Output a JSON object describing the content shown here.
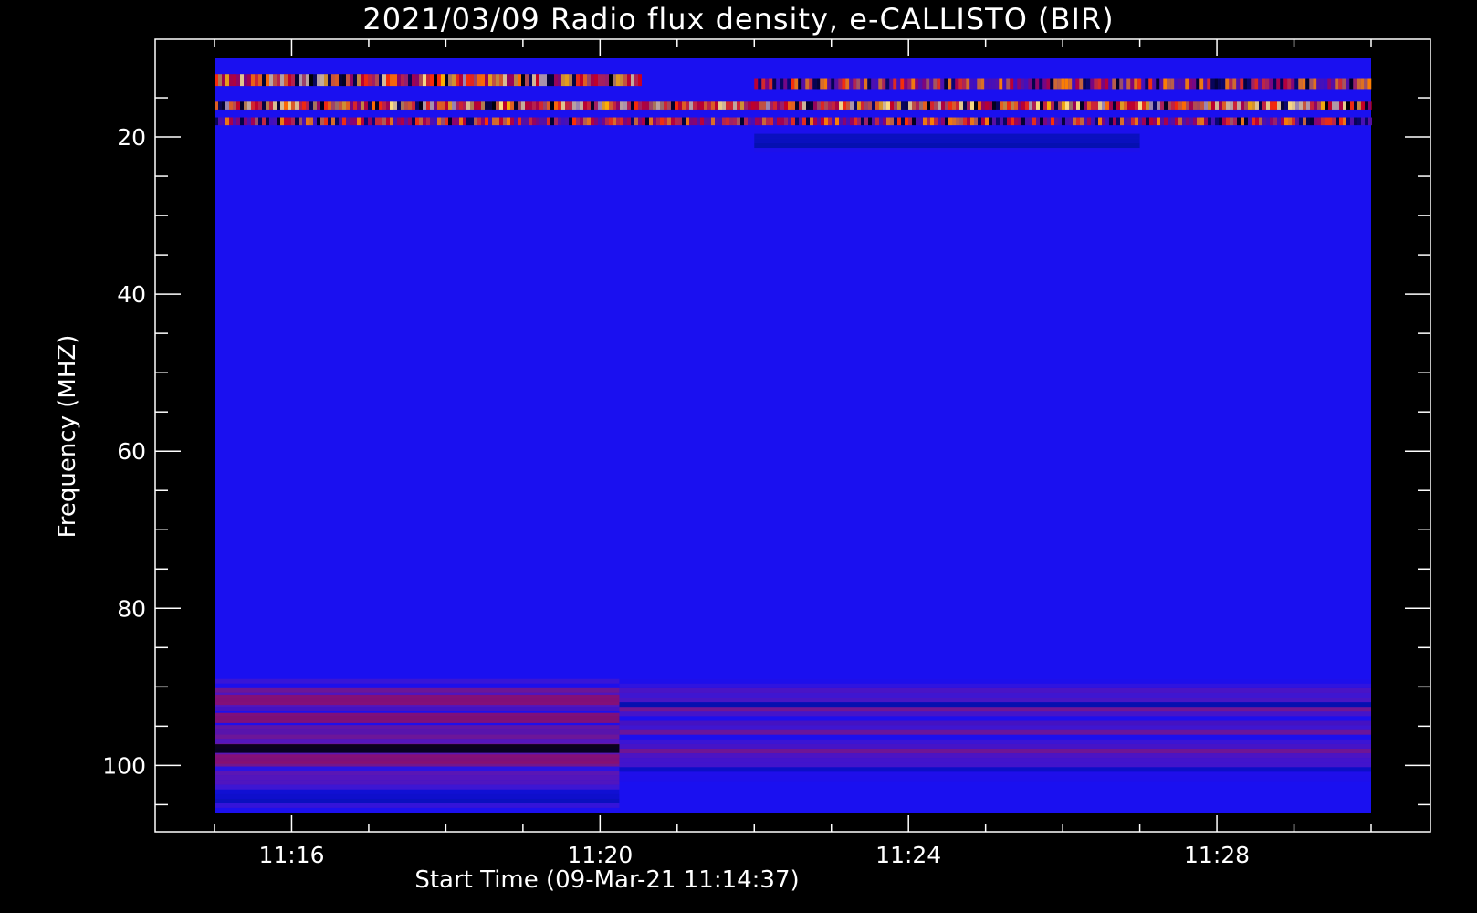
{
  "chart_data": {
    "type": "heatmap",
    "title": "2021/03/09  Radio flux density, e-CALLISTO (BIR)",
    "xlabel": "Start Time (09-Mar-21 11:14:37)",
    "ylabel": "Frequency (MHZ)",
    "x_ticks": [
      "11:16",
      "11:20",
      "11:24",
      "11:28"
    ],
    "x_tick_minutes": [
      16,
      20,
      24,
      28
    ],
    "x_range_minutes": [
      15,
      30
    ],
    "y_ticks": [
      20,
      40,
      60,
      80,
      100
    ],
    "ylim": [
      10,
      106
    ],
    "y_inverted": true,
    "colormap": "blue-red-yellow",
    "background_color": "#1a10f0",
    "grid": false,
    "legend": "none",
    "features": [
      {
        "label": "",
        "freq_range": [
          12,
          13.5
        ],
        "time_range": [
          15,
          20.5
        ],
        "intensity": "high"
      },
      {
        "label": "",
        "freq_range": [
          12.5,
          14
        ],
        "time_range": [
          22,
          30
        ],
        "intensity": "medium"
      },
      {
        "label": "",
        "freq_range": [
          15.5,
          16.5
        ],
        "time_range": [
          15,
          30
        ],
        "intensity": "high"
      },
      {
        "label": "",
        "freq_range": [
          17.5,
          18.5
        ],
        "time_range": [
          15,
          30
        ],
        "intensity": "medium"
      },
      {
        "label": "",
        "freq_range": [
          19,
          22
        ],
        "time_range": [
          22,
          27
        ],
        "intensity": "low"
      },
      {
        "label": "",
        "freq_range": [
          89,
          106
        ],
        "time_range": [
          15,
          20.25
        ],
        "intensity": "low"
      },
      {
        "label": "",
        "freq_range": [
          89,
          102
        ],
        "time_range": [
          20.25,
          30
        ],
        "intensity": "low"
      }
    ]
  }
}
